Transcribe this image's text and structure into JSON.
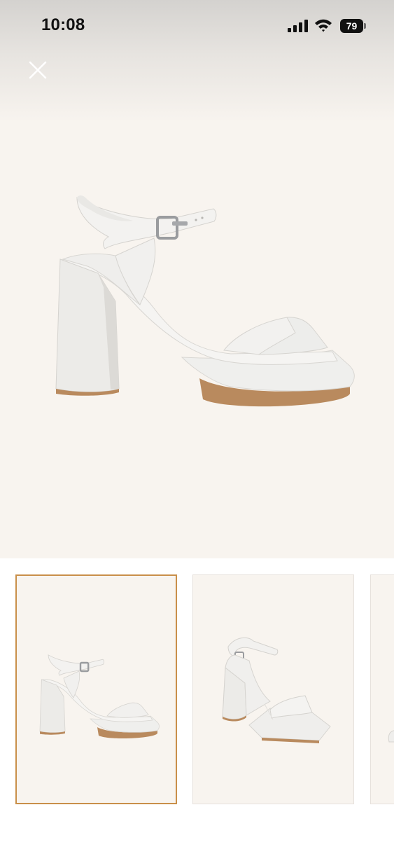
{
  "status_bar": {
    "time": "10:08",
    "battery_level": "79",
    "icons": [
      "cellular-signal-icon",
      "wifi-icon",
      "battery-icon"
    ]
  },
  "toolbar": {
    "close_icon": "close-icon"
  },
  "gallery": {
    "selected_index": 0,
    "thumbnails": [
      {
        "view": "side",
        "selected": true
      },
      {
        "view": "front-angle",
        "selected": false
      },
      {
        "view": "partial",
        "selected": false
      }
    ]
  },
  "colors": {
    "background": "#f8f4ef",
    "selected_border": "#c98f49",
    "thumbnail_border": "#e6e1dc"
  }
}
